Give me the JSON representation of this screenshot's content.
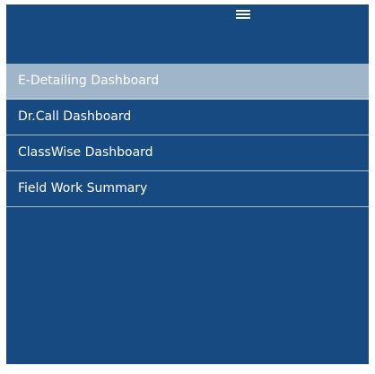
{
  "header": {
    "menu_icon": "hamburger-menu-icon"
  },
  "menu": {
    "items": [
      {
        "label": "E-Detailing Dashboard",
        "active": true
      },
      {
        "label": "Dr.Call Dashboard",
        "active": false
      },
      {
        "label": "ClassWise Dashboard",
        "active": false
      },
      {
        "label": "Field Work Summary",
        "active": false
      }
    ]
  },
  "colors": {
    "panel_background": "#164a80",
    "active_item_background": "#a0b4ca",
    "divider": "#a9bccf",
    "text": "#ffffff"
  }
}
